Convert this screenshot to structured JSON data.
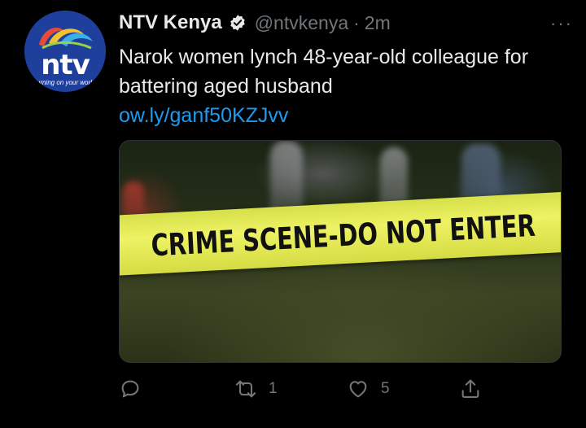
{
  "tweet": {
    "author_name": "NTV Kenya",
    "handle": "@ntvkenya",
    "separator": "·",
    "time": "2m",
    "more": "···",
    "text": "Narok women lynch 48-year-old colleague for battering aged husband",
    "link": "ow.ly/ganf50KZJvv"
  },
  "avatar": {
    "brand": "ntv",
    "tagline": "turning on your world"
  },
  "media": {
    "tape_text": "CRIME SCENE-DO NOT ENTER"
  },
  "actions": {
    "reply_count": "",
    "retweet_count": "1",
    "like_count": "5"
  },
  "icons": {
    "verified": "verified-badge-icon",
    "reply": "reply-icon",
    "retweet": "retweet-icon",
    "like": "heart-icon",
    "share": "share-icon"
  },
  "colors": {
    "background": "#000000",
    "link": "#1d9bf0",
    "muted": "#71767b",
    "text": "#e7e9ea",
    "avatar_bg": "#1f3f9c"
  }
}
